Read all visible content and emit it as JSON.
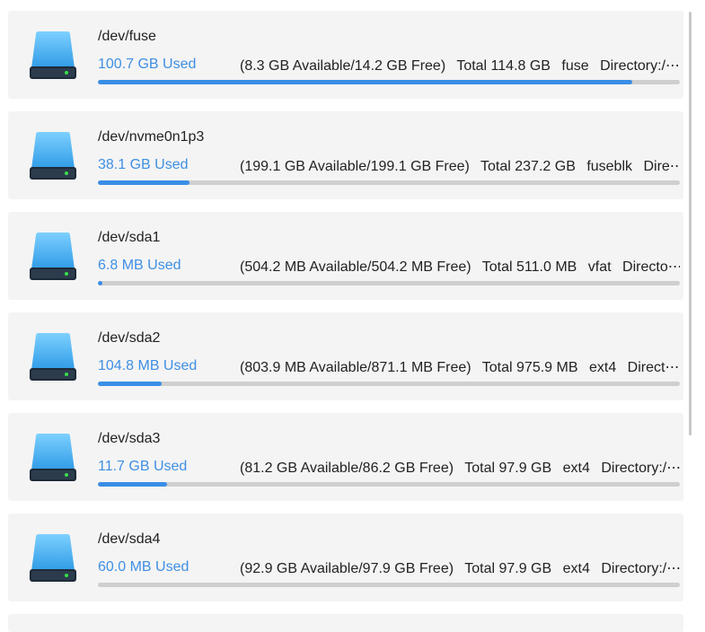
{
  "devices": [
    {
      "name": "/dev/fuse",
      "used": "100.7 GB Used",
      "available": "(8.3 GB Available/14.2 GB Free)",
      "total": "Total 114.8 GB",
      "fs": "fuse",
      "directory": "Directory:/⋯",
      "usage_fraction": 0.918
    },
    {
      "name": "/dev/nvme0n1p3",
      "used": "38.1 GB Used",
      "available": "(199.1 GB Available/199.1 GB Free)",
      "total": "Total 237.2 GB",
      "fs": "fuseblk",
      "directory": "Dire⋯",
      "usage_fraction": 0.158
    },
    {
      "name": "/dev/sda1",
      "used": "6.8 MB Used",
      "available": "(504.2 MB Available/504.2 MB Free)",
      "total": "Total 511.0 MB",
      "fs": "vfat",
      "directory": "Directo⋯",
      "usage_fraction": 0.008
    },
    {
      "name": "/dev/sda2",
      "used": "104.8 MB Used",
      "available": "(803.9 MB Available/871.1 MB Free)",
      "total": "Total 975.9 MB",
      "fs": "ext4",
      "directory": "Direct⋯",
      "usage_fraction": 0.109
    },
    {
      "name": "/dev/sda3",
      "used": "11.7 GB Used",
      "available": "(81.2 GB Available/86.2 GB Free)",
      "total": "Total 97.9 GB",
      "fs": "ext4",
      "directory": "Directory:/⋯",
      "usage_fraction": 0.119
    },
    {
      "name": "/dev/sda4",
      "used": "60.0 MB Used",
      "available": "(92.9 GB Available/97.9 GB Free)",
      "total": "Total 97.9 GB",
      "fs": "ext4",
      "directory": "Directory:/⋯",
      "usage_fraction": 0.0006
    }
  ],
  "colors": {
    "accent": "#3a8ee6",
    "used_text": "#3f8fe4",
    "card_bg": "#f4f4f4",
    "track": "#cfcfcf"
  },
  "icons": {
    "device": "hard-drive-icon"
  }
}
